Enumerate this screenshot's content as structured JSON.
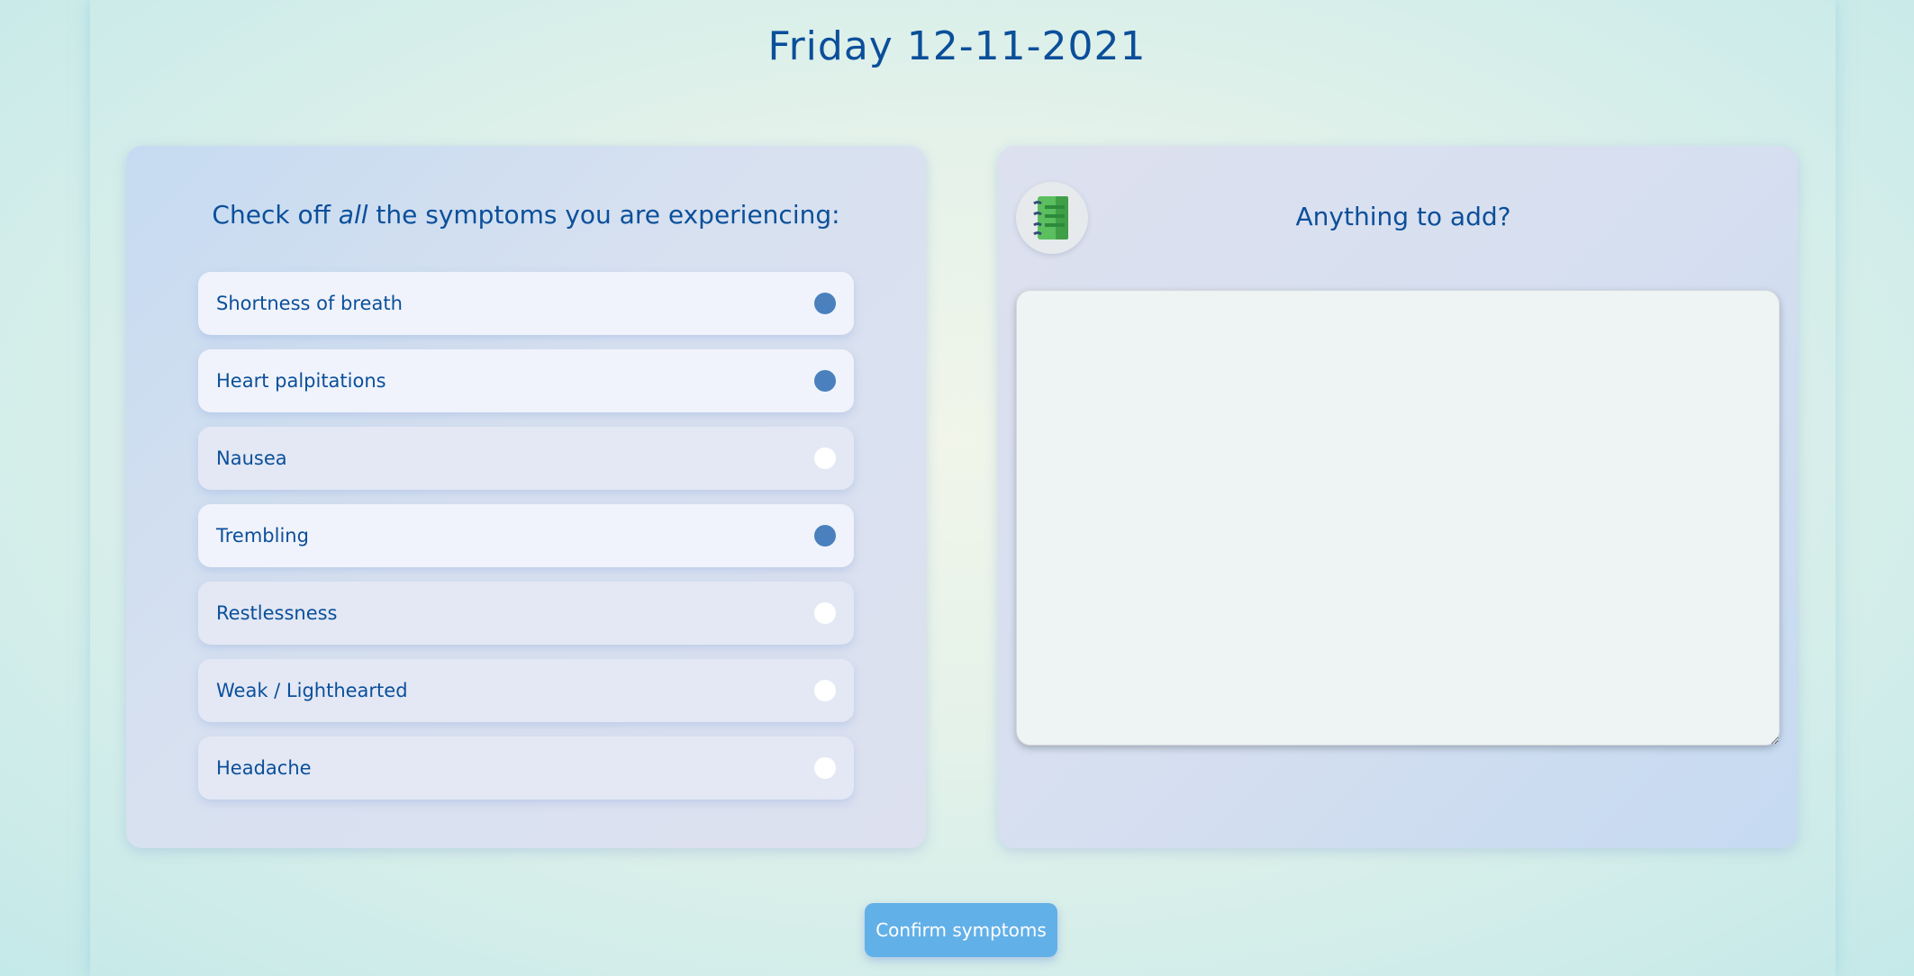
{
  "header": {
    "date": "Friday 12-11-2021"
  },
  "symptoms_panel": {
    "heading_prefix": "Check off ",
    "heading_emphasis": "all",
    "heading_suffix": " the symptoms you are experiencing:",
    "items": [
      {
        "label": "Shortness of breath",
        "checked": true
      },
      {
        "label": "Heart palpitations",
        "checked": true
      },
      {
        "label": "Nausea",
        "checked": false
      },
      {
        "label": "Trembling",
        "checked": true
      },
      {
        "label": "Restlessness",
        "checked": false
      },
      {
        "label": "Weak / Lighthearted",
        "checked": false
      },
      {
        "label": "Headache",
        "checked": false
      }
    ]
  },
  "notes_panel": {
    "heading": "Anything to add?",
    "icon": "notebook-icon",
    "value": ""
  },
  "actions": {
    "confirm_label": "Confirm symptoms"
  },
  "colors": {
    "text": "#0b4f9a",
    "radio_checked": "#4a80bd",
    "radio_unchecked": "#ffffff",
    "button": "#62b0e8"
  }
}
